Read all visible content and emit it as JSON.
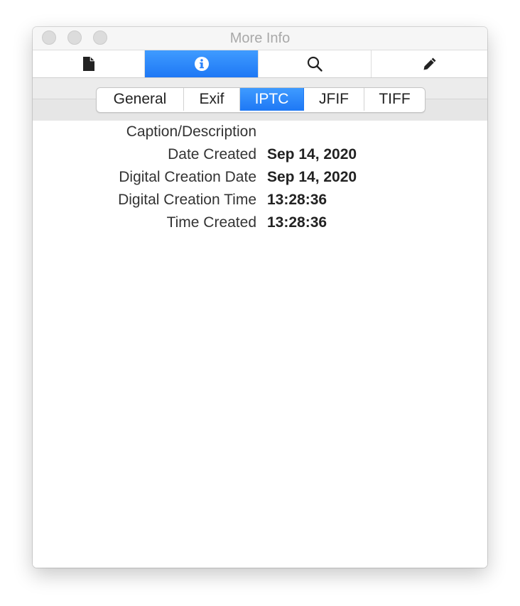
{
  "window": {
    "title": "More Info"
  },
  "toolbar": {
    "tabs": [
      {
        "icon": "document-icon",
        "active": false
      },
      {
        "icon": "info-icon",
        "active": true
      },
      {
        "icon": "search-icon",
        "active": false
      },
      {
        "icon": "pencil-icon",
        "active": false
      }
    ]
  },
  "segments": {
    "items": [
      {
        "label": "General",
        "active": false
      },
      {
        "label": "Exif",
        "active": false
      },
      {
        "label": "IPTC",
        "active": true
      },
      {
        "label": "JFIF",
        "active": false
      },
      {
        "label": "TIFF",
        "active": false
      }
    ]
  },
  "properties": [
    {
      "label": "Caption/Description",
      "value": ""
    },
    {
      "label": "Date Created",
      "value": "Sep 14, 2020"
    },
    {
      "label": "Digital Creation Date",
      "value": "Sep 14, 2020"
    },
    {
      "label": "Digital Creation Time",
      "value": "13:28:36"
    },
    {
      "label": "Time Created",
      "value": "13:28:36"
    }
  ],
  "colors": {
    "accent": "#1e78f5",
    "window_bg": "#ffffff",
    "title_text": "#a9a9a9"
  }
}
